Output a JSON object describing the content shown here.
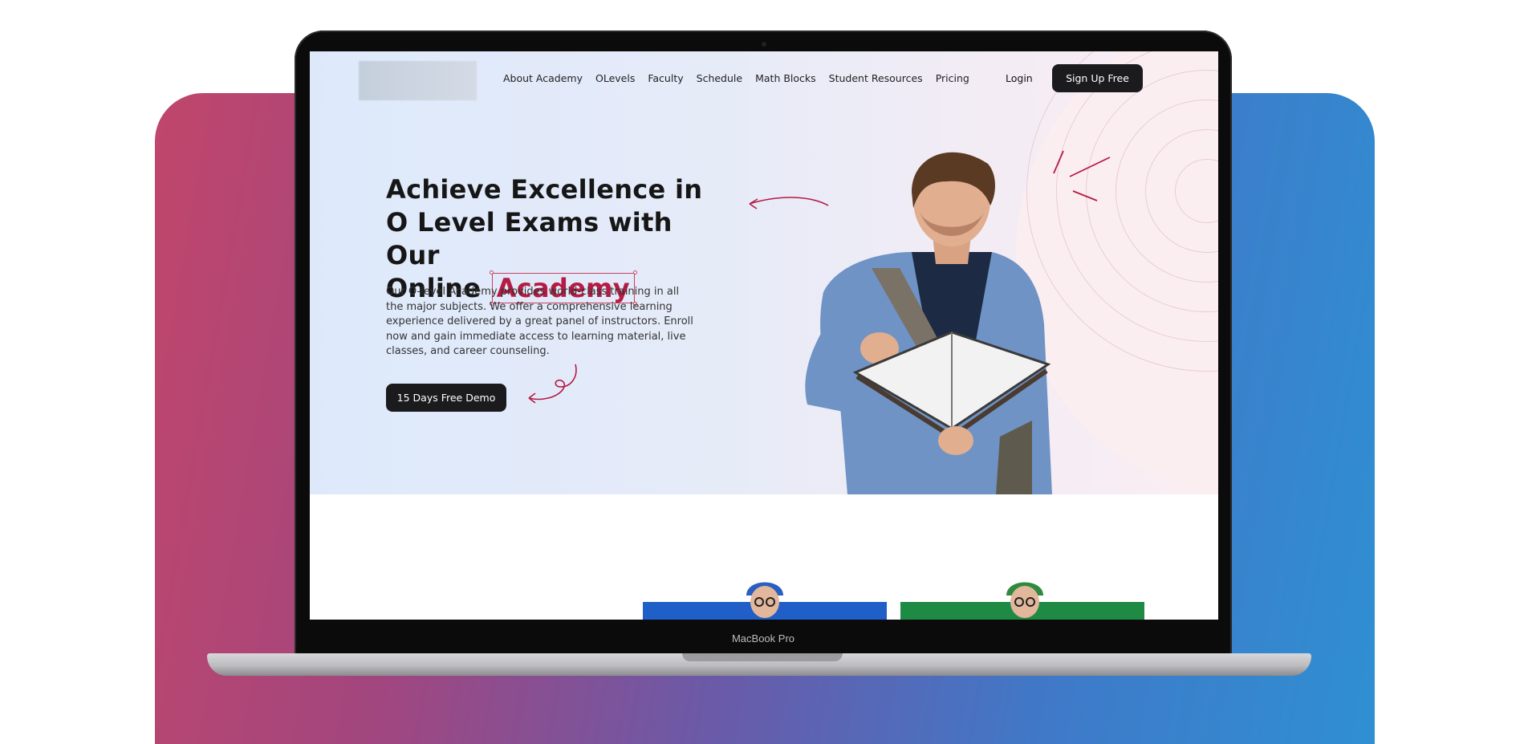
{
  "nav": {
    "items": [
      "About Academy",
      "OLevels",
      "Faculty",
      "Schedule",
      "Math Blocks",
      "Student Resources",
      "Pricing"
    ],
    "login_label": "Login",
    "signup_label": "Sign Up Free"
  },
  "hero": {
    "headline_line1": "Achieve Excellence in",
    "headline_line2": "O Level Exams with Our",
    "headline_line3_prefix": "Online",
    "headline_highlight": "Academy",
    "description": "Our O-level Academy provides world-class training in all the major subjects. We offer a comprehensive learning experience delivered by a great panel of instructors. Enroll now and gain immediate access to learning material, live classes, and career counseling.",
    "cta_label": "15 Days Free Demo"
  },
  "device": {
    "label": "MacBook Pro"
  },
  "colors": {
    "accent": "#b51b43",
    "button_dark": "#1b1b1d",
    "card_blue": "#1f5fc7",
    "card_green": "#1f8a44"
  },
  "icons": [
    "logo-placeholder",
    "curved-arrow-icon",
    "swirl-arrow-icon",
    "spark-lines-icon"
  ]
}
